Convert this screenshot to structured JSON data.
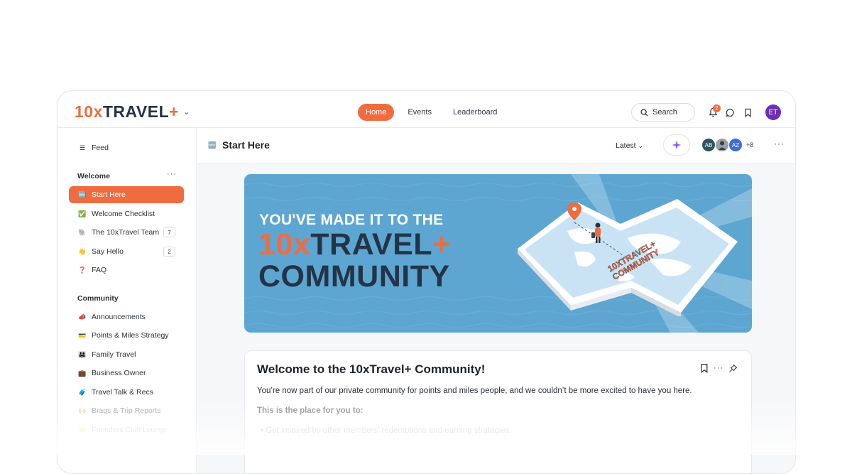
{
  "brand": {
    "num": "10x",
    "word": "TRAVEL",
    "plus": "+"
  },
  "nav": {
    "tabs": [
      {
        "label": "Home"
      },
      {
        "label": "Events"
      },
      {
        "label": "Leaderboard"
      }
    ]
  },
  "search": {
    "label": "Search"
  },
  "notifications": {
    "count": "2"
  },
  "user": {
    "initials": "ET"
  },
  "sidebar": {
    "feed": {
      "emoji": "☰",
      "label": "Feed"
    },
    "welcome": {
      "heading": "Welcome",
      "items": [
        {
          "emoji": "🆕",
          "label": "Start Here"
        },
        {
          "emoji": "✅",
          "label": "Welcome Checklist"
        },
        {
          "emoji": "🐘",
          "label": "The 10xTravel Team",
          "count": "7"
        },
        {
          "emoji": "👋",
          "label": "Say Hello",
          "count": "2"
        },
        {
          "emoji": "❓",
          "label": "FAQ"
        }
      ]
    },
    "community": {
      "heading": "Community",
      "items": [
        {
          "emoji": "📣",
          "label": "Announcements"
        },
        {
          "emoji": "💳",
          "label": "Points & Miles Strategy"
        },
        {
          "emoji": "👨‍👩‍👧",
          "label": "Family Travel"
        },
        {
          "emoji": "💼",
          "label": "Business Owner"
        },
        {
          "emoji": "🧳",
          "label": "Travel Talk & Recs"
        },
        {
          "emoji": "🙌",
          "label": "Brags & Trip Reports"
        },
        {
          "emoji": "🤝",
          "label": "Founders Club Lounge"
        }
      ]
    }
  },
  "main": {
    "title_emoji": "🆕",
    "title": "Start Here",
    "sort": "Latest",
    "members": [
      {
        "initials": "AB",
        "color": "#2f5560"
      },
      {
        "initials": "",
        "color": "#9aa0a6"
      },
      {
        "initials": "AZ",
        "color": "#3b6fd6"
      }
    ],
    "members_more": "+8"
  },
  "banner": {
    "line1": "YOU'VE MADE IT TO THE",
    "line2_num": "10x",
    "line2_word": "TRAVEL",
    "line2_plus": "+",
    "line3": "COMMUNITY",
    "map_label_1": "10XTRAVEL+",
    "map_label_2": "COMMUNITY"
  },
  "post": {
    "title": "Welcome to the 10xTravel+ Community!",
    "body": "You’re now part of our private community for points and miles people, and we couldn’t be more excited to have you here.",
    "subheading": "This is the place for you to:",
    "bullet": "Get inspired by other members’ redemptions and earning strategies"
  },
  "colors": {
    "accent": "#ef6c3f",
    "navy": "#233447",
    "banner_blue": "#5ea6d2",
    "avatar_purple": "#6b2fb8"
  }
}
